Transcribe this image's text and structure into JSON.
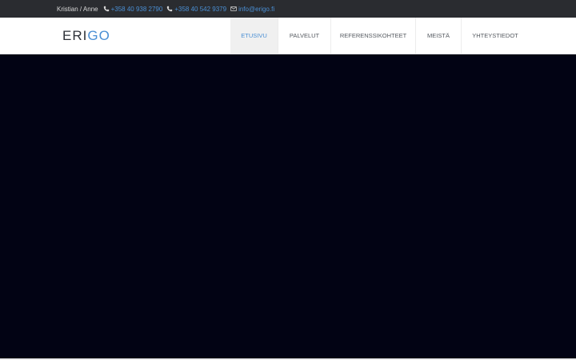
{
  "topbar": {
    "names": "Kristian / Anne",
    "phone1": "+358 40 938 2790",
    "phone2": "+358 40 542 9379",
    "email": "info@erigo.fi"
  },
  "logo": {
    "part1": "ERI",
    "part2": "GO"
  },
  "nav": {
    "items": [
      {
        "label": "ETUSIVU"
      },
      {
        "label": "PALVELUT"
      },
      {
        "label": "REFERENSSIKOHTEET"
      },
      {
        "label": "MEISTÄ"
      },
      {
        "label": "YHTEYSTIEDOT"
      }
    ]
  },
  "colors": {
    "topbar_bg": "#2a2c30",
    "accent": "#4a8fd4",
    "hero_bg": "#020314"
  },
  "icons": {
    "phone": "phone-icon",
    "email": "envelope-icon"
  }
}
